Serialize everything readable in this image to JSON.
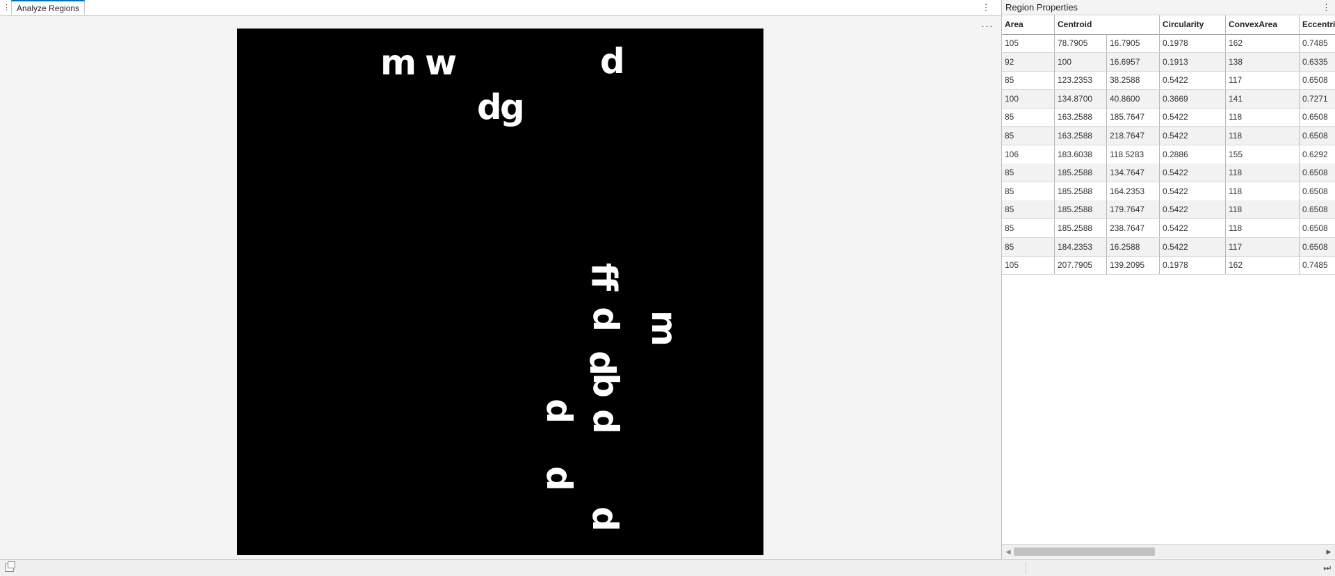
{
  "tab": {
    "label": "Analyze Regions"
  },
  "tab_menu_glyph": "⋮",
  "axes_menu_glyph": "···",
  "panel": {
    "title": "Region Properties",
    "menu_glyph": "⋮"
  },
  "table": {
    "headers": [
      "Area",
      "Centroid",
      "",
      "Circularity",
      "ConvexArea",
      "Eccentric"
    ],
    "rows": [
      [
        "105",
        "78.7905",
        "16.7905",
        "0.1978",
        "162",
        "0.7485"
      ],
      [
        "92",
        "100",
        "16.6957",
        "0.1913",
        "138",
        "0.6335"
      ],
      [
        "85",
        "123.2353",
        "38.2588",
        "0.5422",
        "117",
        "0.6508"
      ],
      [
        "100",
        "134.8700",
        "40.8600",
        "0.3669",
        "141",
        "0.7271"
      ],
      [
        "85",
        "163.2588",
        "185.7647",
        "0.5422",
        "118",
        "0.6508"
      ],
      [
        "85",
        "163.2588",
        "218.7647",
        "0.5422",
        "118",
        "0.6508"
      ],
      [
        "106",
        "183.6038",
        "118.5283",
        "0.2886",
        "155",
        "0.6292"
      ],
      [
        "85",
        "185.2588",
        "134.7647",
        "0.5422",
        "118",
        "0.6508"
      ],
      [
        "85",
        "185.2588",
        "164.2353",
        "0.5422",
        "118",
        "0.6508"
      ],
      [
        "85",
        "185.2588",
        "179.7647",
        "0.5422",
        "118",
        "0.6508"
      ],
      [
        "85",
        "185.2588",
        "238.7647",
        "0.5422",
        "118",
        "0.6508"
      ],
      [
        "85",
        "184.2353",
        "16.2588",
        "0.5422",
        "117",
        "0.6508"
      ],
      [
        "105",
        "207.7905",
        "139.2095",
        "0.1978",
        "162",
        "0.7485"
      ]
    ]
  },
  "image_glyphs": [
    "m",
    "w",
    "d",
    "d",
    "g",
    "d",
    "ff",
    "d",
    "m",
    "b",
    "d",
    "d",
    "d",
    "d"
  ],
  "scroll": {
    "left_arrow": "◀",
    "right_arrow": "▶"
  },
  "status": {
    "right_glyph": "⏭"
  }
}
